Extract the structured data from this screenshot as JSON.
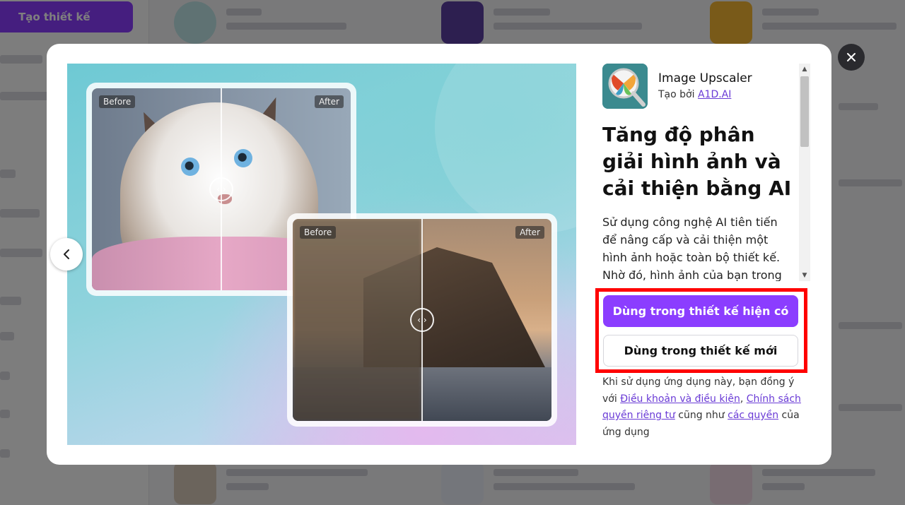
{
  "background": {
    "create_label": "Tạo thiết kế"
  },
  "modal": {
    "app": {
      "name": "Image Upscaler",
      "creator_prefix": "Tạo bởi",
      "creator_link": "A1D.AI"
    },
    "headline": "Tăng độ phân giải hình ảnh và cải thiện bằng AI",
    "description": "Sử dụng công nghệ AI tiên tiến để nâng cấp và cải thiện một hình ảnh hoặc toàn bộ thiết kế. Nhờ đó, hình ảnh của bạn trong",
    "preview": {
      "before_label": "Before",
      "after_label": "After"
    },
    "buttons": {
      "use_existing": "Dùng trong thiết kế hiện có",
      "use_new": "Dùng trong thiết kế mới"
    },
    "terms": {
      "prefix": "Khi sử dụng ứng dụng này, bạn đồng ý với",
      "link1": "Điều khoản và điều kiện",
      "sep": ",",
      "link2": "Chính sách quyền riêng tư",
      "mid": "cũng như",
      "link3": "các quyền",
      "suffix": "của ứng dụng"
    },
    "icons": {
      "close": "close-icon",
      "prev": "chevron-left-icon"
    },
    "colors": {
      "primary": "#8b3dff",
      "highlight": "#ff0000",
      "link": "#6a3bd6"
    }
  }
}
